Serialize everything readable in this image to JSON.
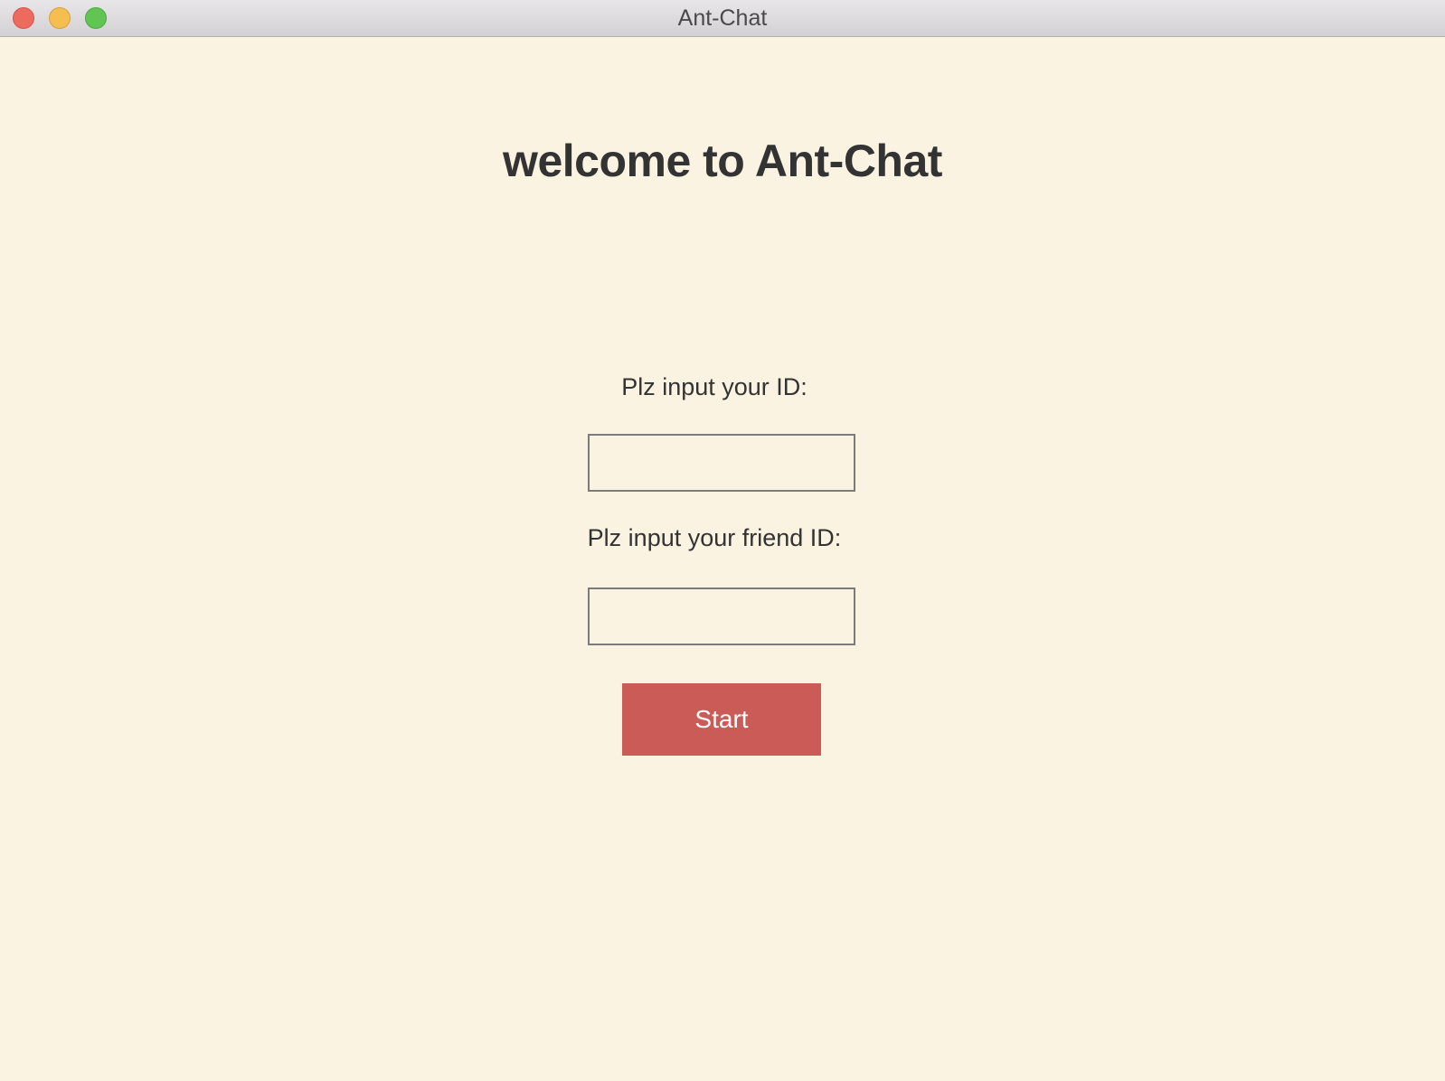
{
  "window": {
    "title": "Ant-Chat",
    "background_color": "#faf3e1"
  },
  "titlebar": {
    "buttons": [
      {
        "name": "close",
        "color": "#ed6a5e"
      },
      {
        "name": "minimize",
        "color": "#f5bf4f"
      },
      {
        "name": "zoom",
        "color": "#61c554"
      }
    ]
  },
  "main": {
    "heading": "welcome to Ant-Chat",
    "id_label": "Plz input your ID:",
    "id_value": "",
    "friend_label": "Plz input your friend ID:",
    "friend_value": "",
    "start_label": "Start",
    "start_color": "#ca5b56"
  }
}
